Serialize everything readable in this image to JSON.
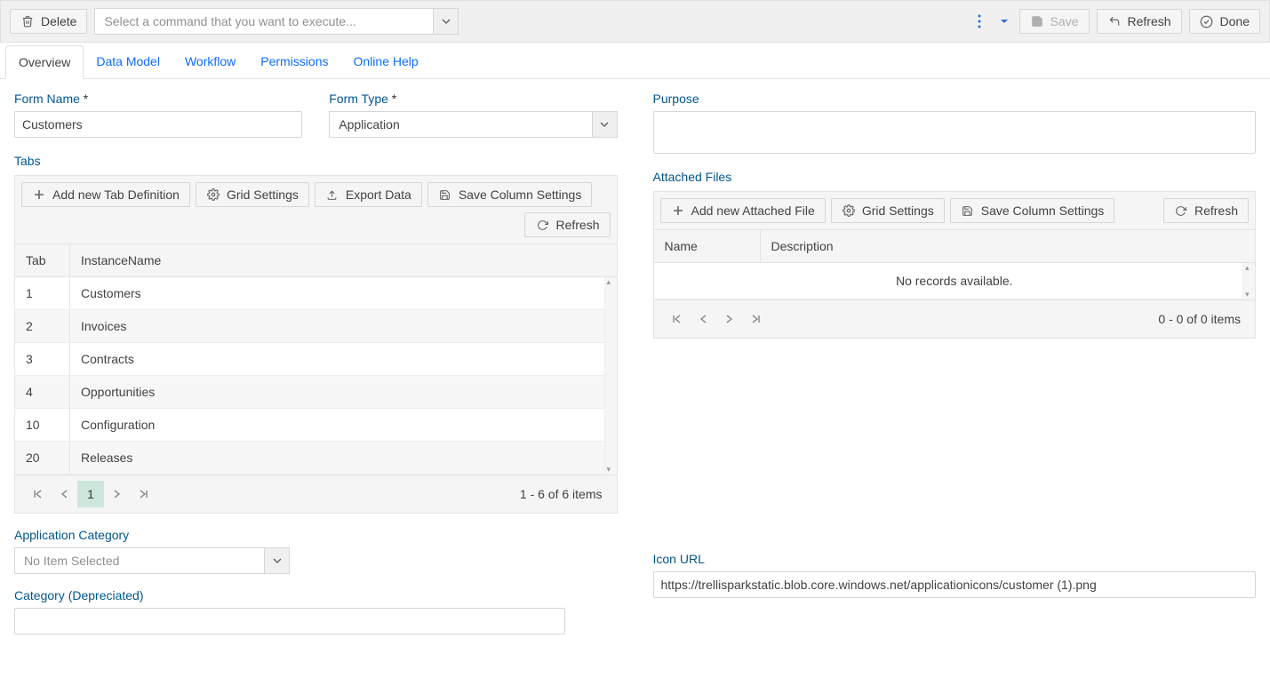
{
  "toolbar": {
    "delete": "Delete",
    "command_placeholder": "Select a command that you want to execute...",
    "save": "Save",
    "refresh": "Refresh",
    "done": "Done"
  },
  "tabs_nav": {
    "overview": "Overview",
    "data_model": "Data Model",
    "workflow": "Workflow",
    "permissions": "Permissions",
    "online_help": "Online Help"
  },
  "form": {
    "form_name_label": "Form Name",
    "form_name_value": "Customers",
    "form_type_label": "Form Type",
    "form_type_value": "Application",
    "purpose_label": "Purpose",
    "purpose_value": "",
    "app_category_label": "Application Category",
    "app_category_placeholder": "No Item Selected",
    "category_depr_label": "Category (Depreciated)",
    "category_depr_value": "",
    "icon_url_label": "Icon URL",
    "icon_url_value": "https://trellisparkstatic.blob.core.windows.net/applicationicons/customer (1).png"
  },
  "tabs_grid": {
    "label": "Tabs",
    "add": "Add new Tab Definition",
    "grid_settings": "Grid Settings",
    "export": "Export Data",
    "save_cols": "Save Column Settings",
    "refresh": "Refresh",
    "col_tab": "Tab",
    "col_instance": "InstanceName",
    "rows": [
      {
        "tab": "1",
        "name": "Customers"
      },
      {
        "tab": "2",
        "name": "Invoices"
      },
      {
        "tab": "3",
        "name": "Contracts"
      },
      {
        "tab": "4",
        "name": "Opportunities"
      },
      {
        "tab": "10",
        "name": "Configuration"
      },
      {
        "tab": "20",
        "name": "Releases"
      }
    ],
    "page_num": "1",
    "page_info": "1 - 6 of 6 items"
  },
  "files_grid": {
    "label": "Attached Files",
    "add": "Add new Attached File",
    "grid_settings": "Grid Settings",
    "save_cols": "Save Column Settings",
    "refresh": "Refresh",
    "col_name": "Name",
    "col_desc": "Description",
    "no_records": "No records available.",
    "page_info": "0 - 0 of 0 items"
  }
}
